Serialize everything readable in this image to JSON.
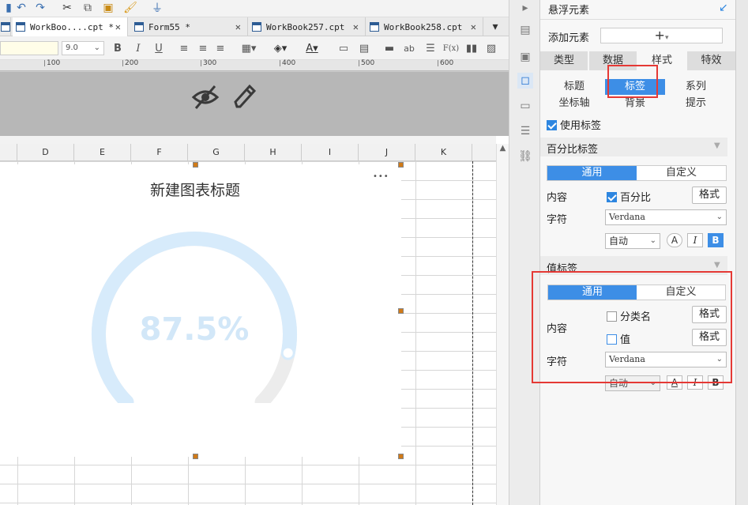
{
  "tabs": [
    {
      "label": "WorkBoo....cpt *"
    },
    {
      "label": "Form55 *"
    },
    {
      "label": "WorkBook257.cpt"
    },
    {
      "label": "WorkBook258.cpt"
    }
  ],
  "format_toolbar": {
    "font_size": "9.0",
    "bold": "B",
    "italic": "I",
    "underline": "U",
    "ab": "ab",
    "fx": "F(x)"
  },
  "ruler": [
    "100",
    "200",
    "300",
    "400",
    "500",
    "600"
  ],
  "columns": [
    "D",
    "E",
    "F",
    "G",
    "H",
    "I",
    "J",
    "K"
  ],
  "chart": {
    "title": "新建图表标题",
    "value_label": "87.5%",
    "more": "•••",
    "percent": 87.5,
    "colors": {
      "fill": "#d7ebfb",
      "track": "#ececec",
      "label": "#d2e7f8"
    }
  },
  "panel": {
    "title": "悬浮元素",
    "add_element_label": "添加元素",
    "add_symbol": "+",
    "main_tabs": [
      "类型",
      "数据",
      "样式",
      "特效"
    ],
    "sub_tabs": [
      "标题",
      "标签",
      "系列",
      "坐标轴",
      "背景",
      "提示"
    ],
    "use_label": "使用标签",
    "percent_section": "百分比标签",
    "general": "通用",
    "custom": "自定义",
    "content": "内容",
    "percent": "百分比",
    "format": "格式",
    "char": "字符",
    "font": "Verdana",
    "auto": "自动",
    "value_section": "值标签",
    "category_name": "分类名",
    "value": "值",
    "italic": "I",
    "bold": "B"
  }
}
